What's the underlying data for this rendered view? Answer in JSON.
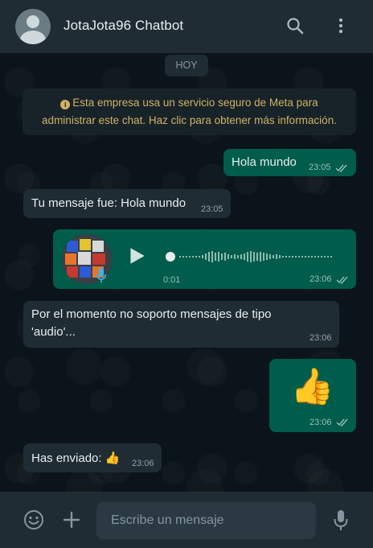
{
  "header": {
    "title": "JotaJota96 Chatbot",
    "icons": [
      "avatar",
      "search-icon",
      "menu-icon"
    ]
  },
  "date_chip": "HOY",
  "system_note": {
    "line1": "Esta empresa usa un servicio seguro de Meta para",
    "line2": "administrar este chat. Haz clic para obtener más información.",
    "icon": "info-icon"
  },
  "messages": [
    {
      "direction": "out",
      "text": "Hola mundo",
      "time": "23:05",
      "ticks": "double"
    },
    {
      "direction": "in",
      "text": "Tu mensaje fue: Hola mundo",
      "time": "23:05"
    },
    {
      "direction": "out",
      "type": "audio",
      "duration": "0:01",
      "time": "23:06",
      "ticks": "double",
      "progress": 0.0
    },
    {
      "direction": "in",
      "line1": "Por el momento no soporto mensajes de tipo",
      "line2": "'audio'...",
      "time": "23:06"
    },
    {
      "direction": "out",
      "type": "sticker",
      "emoji": "👍",
      "time": "23:06",
      "ticks": "double"
    },
    {
      "direction": "in",
      "text": "Has enviado: 👍",
      "time": "23:06"
    }
  ],
  "input": {
    "placeholder": "Escribe un mensaje"
  },
  "colors": {
    "header_bg": "#1f2c34",
    "chat_bg": "#0b141a",
    "incoming_bubble": "#1f2c34",
    "outgoing_bubble": "#005c4b",
    "ticks": "#99beb7"
  }
}
